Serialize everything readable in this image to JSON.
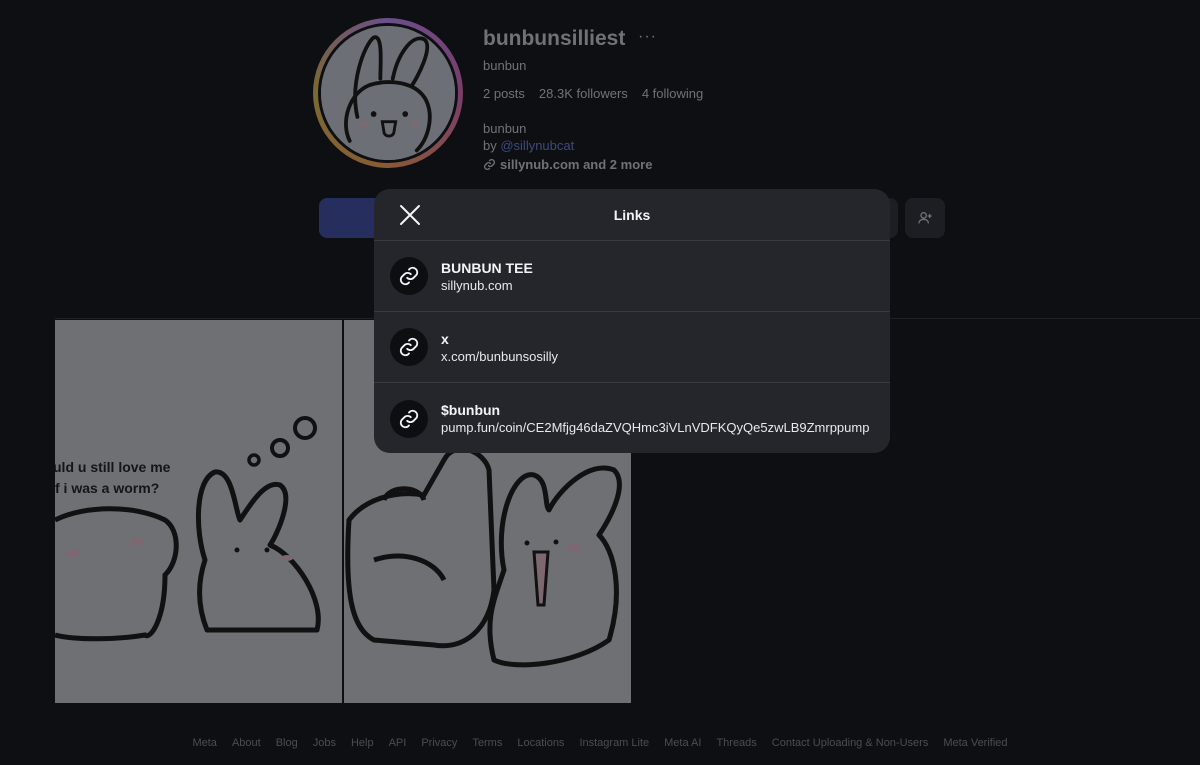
{
  "profile": {
    "username": "bunbunsilliest",
    "more_options": "···",
    "display_name": "bunbun",
    "stats": {
      "posts": "2 posts",
      "followers": "28.3K followers",
      "following": "4 following"
    },
    "bio_name": "bunbun",
    "bio_by_prefix": "by ",
    "bio_mention": "@sillynubcat",
    "bio_link": "sillynub.com and 2 more"
  },
  "posts_overlay_text": {
    "caption_line1": "uld u still love me",
    "caption_line2": "f i was a worm?"
  },
  "modal": {
    "title": "Links",
    "close_icon": "close-icon",
    "links": [
      {
        "title": "BUNBUN TEE",
        "url": "sillynub.com",
        "icon": "link-icon"
      },
      {
        "title": "x",
        "url": "x.com/bunbunsosilly",
        "icon": "link-icon"
      },
      {
        "title": "$bunbun",
        "url": "pump.fun/coin/CE2Mfjg46daZVQHmc3iVLnVDFKQyQe5zwLB9Zmrppump",
        "icon": "link-icon"
      }
    ]
  },
  "footer": {
    "links": [
      "Meta",
      "About",
      "Blog",
      "Jobs",
      "Help",
      "API",
      "Privacy",
      "Terms",
      "Locations",
      "Instagram Lite",
      "Meta AI",
      "Threads",
      "Contact Uploading & Non-Users",
      "Meta Verified"
    ]
  },
  "colors": {
    "background": "#0d0f13",
    "modal_bg": "#25262b",
    "follow_button": "#262e5e",
    "mention": "#3f4a78"
  }
}
